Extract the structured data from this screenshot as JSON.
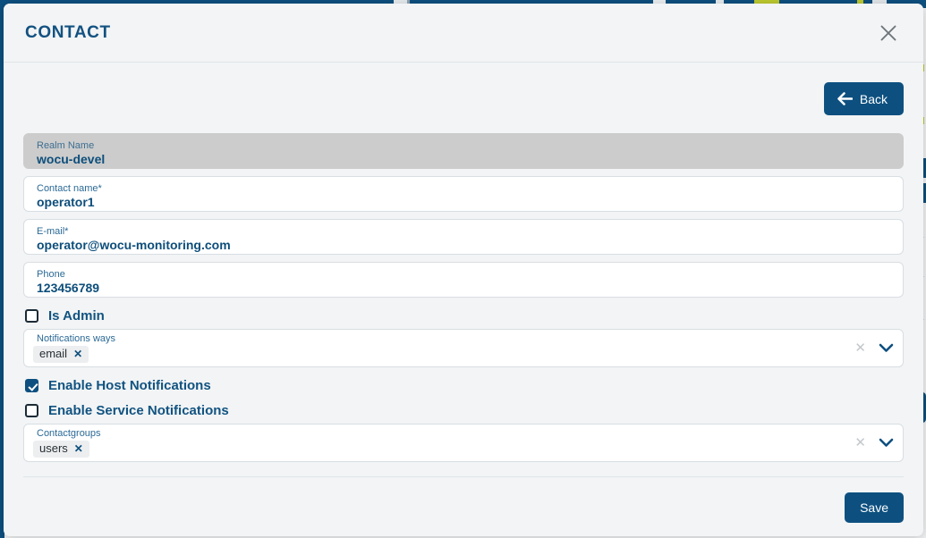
{
  "background": {
    "topbar_color": "#0d5080",
    "accent_chip_color": "#bfcb2f"
  },
  "modal": {
    "title": "CONTACT",
    "close_icon": "close-icon",
    "toolbar": {
      "back_label": "Back",
      "back_icon": "arrow-left-icon"
    },
    "footer": {
      "save_label": "Save"
    },
    "fields": [
      {
        "name": "realm-name",
        "label": "Realm Name",
        "value": "wocu-devel",
        "required": false,
        "disabled": true
      },
      {
        "name": "contact-name",
        "label": "Contact name",
        "value": "operator1",
        "required": true,
        "disabled": false
      },
      {
        "name": "email",
        "label": "E-mail",
        "value": "operator@wocu-monitoring.com",
        "required": true,
        "disabled": false
      },
      {
        "name": "phone",
        "label": "Phone",
        "value": "123456789",
        "required": false,
        "disabled": false
      }
    ],
    "is_admin": {
      "label": "Is Admin",
      "checked": false
    },
    "notifications_ways": {
      "label": "Notifications ways",
      "chips": [
        "email"
      ],
      "clear_icon": "clear-icon",
      "caret_icon": "chevron-down-icon"
    },
    "enable_host_notifications": {
      "label": "Enable Host Notifications",
      "checked": true
    },
    "enable_service_notifications": {
      "label": "Enable Service Notifications",
      "checked": false
    },
    "contactgroups": {
      "label": "Contactgroups",
      "chips": [
        "users"
      ],
      "clear_icon": "clear-icon",
      "caret_icon": "chevron-down-icon"
    },
    "chip_remove_glyph": "✕",
    "clear_glyph": "✕",
    "required_glyph": "*"
  }
}
